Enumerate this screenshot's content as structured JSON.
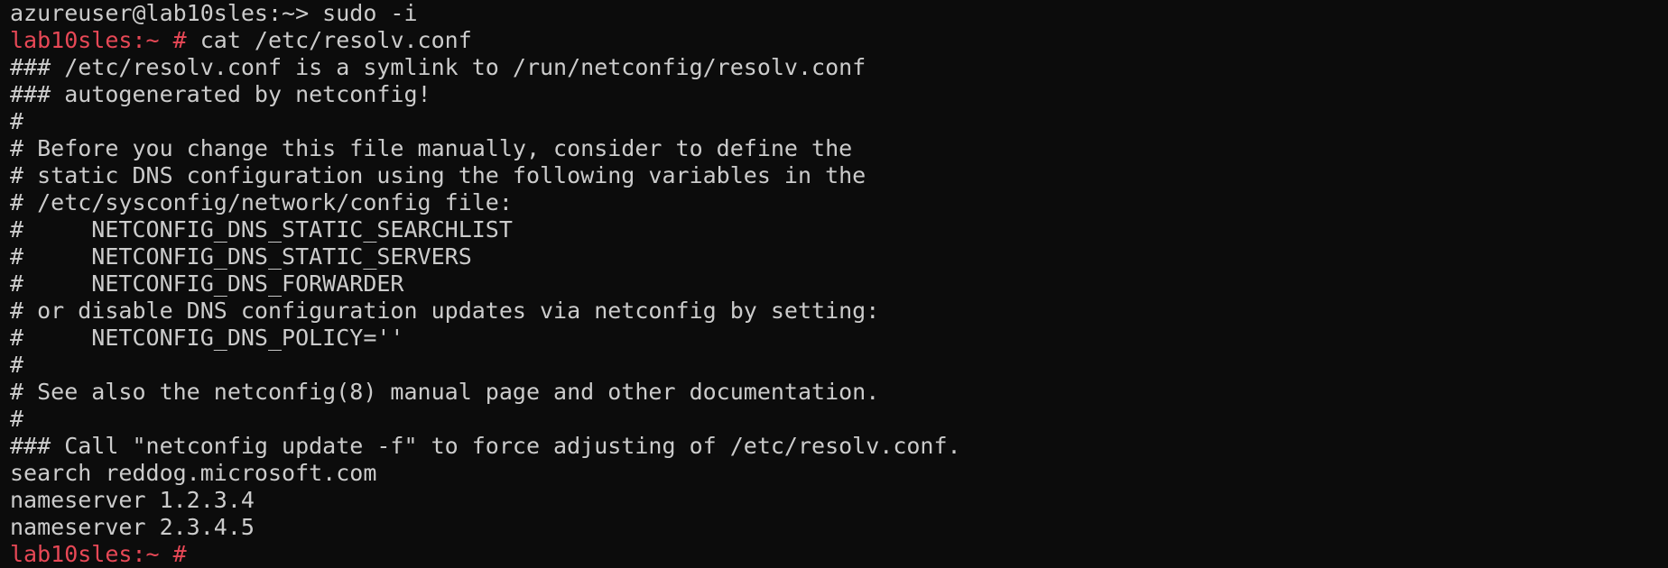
{
  "terminal": {
    "colors": {
      "background": "#0c0c0c",
      "foreground": "#cccccc",
      "prompt": "#e74856"
    },
    "lines": [
      {
        "prompt": "",
        "text": "azureuser@lab10sles:~> sudo -i"
      },
      {
        "prompt": "lab10sles:~ #",
        "text": " cat /etc/resolv.conf"
      },
      {
        "prompt": "",
        "text": "### /etc/resolv.conf is a symlink to /run/netconfig/resolv.conf"
      },
      {
        "prompt": "",
        "text": "### autogenerated by netconfig!"
      },
      {
        "prompt": "",
        "text": "#"
      },
      {
        "prompt": "",
        "text": "# Before you change this file manually, consider to define the"
      },
      {
        "prompt": "",
        "text": "# static DNS configuration using the following variables in the"
      },
      {
        "prompt": "",
        "text": "# /etc/sysconfig/network/config file:"
      },
      {
        "prompt": "",
        "text": "#     NETCONFIG_DNS_STATIC_SEARCHLIST"
      },
      {
        "prompt": "",
        "text": "#     NETCONFIG_DNS_STATIC_SERVERS"
      },
      {
        "prompt": "",
        "text": "#     NETCONFIG_DNS_FORWARDER"
      },
      {
        "prompt": "",
        "text": "# or disable DNS configuration updates via netconfig by setting:"
      },
      {
        "prompt": "",
        "text": "#     NETCONFIG_DNS_POLICY=''"
      },
      {
        "prompt": "",
        "text": "#"
      },
      {
        "prompt": "",
        "text": "# See also the netconfig(8) manual page and other documentation."
      },
      {
        "prompt": "",
        "text": "#"
      },
      {
        "prompt": "",
        "text": "### Call \"netconfig update -f\" to force adjusting of /etc/resolv.conf."
      },
      {
        "prompt": "",
        "text": "search reddog.microsoft.com"
      },
      {
        "prompt": "",
        "text": "nameserver 1.2.3.4"
      },
      {
        "prompt": "",
        "text": "nameserver 2.3.4.5"
      },
      {
        "prompt": "lab10sles:~ #",
        "text": ""
      }
    ]
  }
}
